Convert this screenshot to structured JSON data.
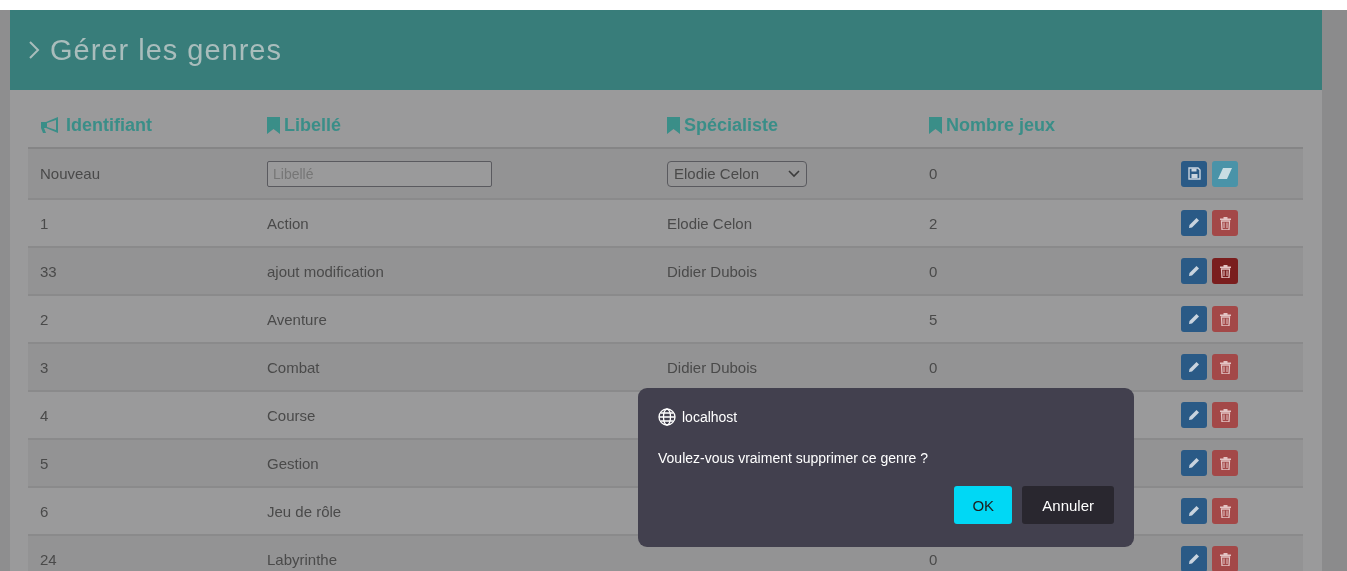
{
  "title": "Gérer les genres",
  "columns": [
    {
      "label": "Identifiant",
      "kind": "bullhorn"
    },
    {
      "label": "Libellé",
      "kind": "bookmark"
    },
    {
      "label": "Spécialiste",
      "kind": "bookmark"
    },
    {
      "label": "Nombre jeux",
      "kind": "bookmark"
    }
  ],
  "new_row": {
    "id": "Nouveau",
    "label_placeholder": "Libellé",
    "specialist": "Elodie Celon",
    "count": "0"
  },
  "rows": [
    {
      "id": "1",
      "label": "Action",
      "specialist": "Elodie Celon",
      "count": "2",
      "delete_active": false
    },
    {
      "id": "33",
      "label": "ajout modification",
      "specialist": "Didier Dubois",
      "count": "0",
      "delete_active": true
    },
    {
      "id": "2",
      "label": "Aventure",
      "count": "5",
      "delete_active": false
    },
    {
      "id": "3",
      "label": "Combat",
      "specialist": "Didier Dubois",
      "count": "0",
      "delete_active": false
    },
    {
      "id": "4",
      "label": "Course",
      "delete_active": false
    },
    {
      "id": "5",
      "label": "Gestion",
      "delete_active": false
    },
    {
      "id": "6",
      "label": "Jeu de rôle",
      "delete_active": false
    },
    {
      "id": "24",
      "label": "Labyrinthe",
      "count": "0",
      "delete_active": false
    }
  ],
  "dialog": {
    "origin": "localhost",
    "message": "Voulez-vous vraiment supprimer ce genre ?",
    "buttons": [
      {
        "label": "OK",
        "kind": "primary"
      },
      {
        "label": "Annuler",
        "kind": "secondary"
      }
    ]
  }
}
